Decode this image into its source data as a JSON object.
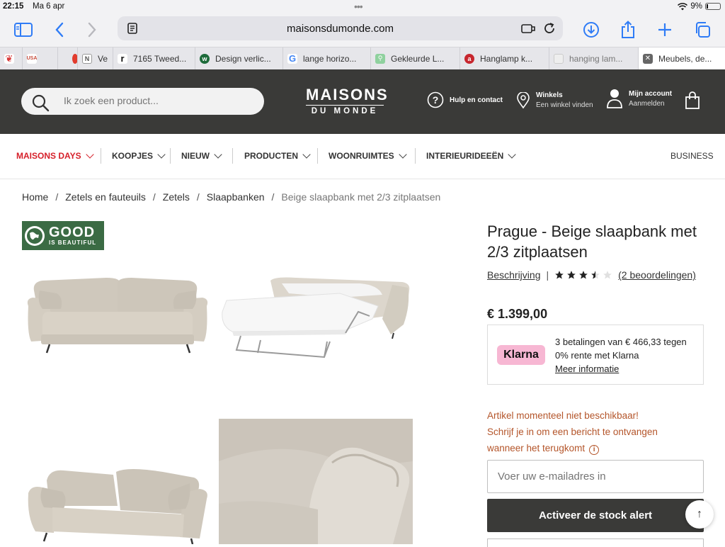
{
  "status": {
    "time": "22:15",
    "date": "Ma 6 apr",
    "battery": "9%"
  },
  "browser": {
    "url": "maisonsdumonde.com"
  },
  "tabs": [
    {
      "label": "",
      "fav_color": "#d93b3b",
      "fav_icon": "leaf-icon"
    },
    {
      "label": "",
      "fav_color": "#c64a3a",
      "fav_icon": "usa-icon"
    },
    {
      "label": "",
      "fav_color": "#e23c2e",
      "fav_icon": "circle-icon"
    },
    {
      "label": "Ve",
      "fav_color": "#555555",
      "fav_icon": "n-icon"
    },
    {
      "label": "7165 Tweed...",
      "fav_color": "#111111",
      "fav_icon": "r-icon"
    },
    {
      "label": "Design verlic...",
      "fav_color": "#1d6b3a",
      "fav_icon": "w-icon"
    },
    {
      "label": "lange horizo...",
      "fav_color": "#4285f4",
      "fav_icon": "google-icon"
    },
    {
      "label": "Gekleurde L...",
      "fav_color": "#8fd19e",
      "fav_icon": "pin-icon"
    },
    {
      "label": "Hanglamp k...",
      "fav_color": "#c7262e",
      "fav_icon": "a-icon"
    },
    {
      "label": "hanging lam...",
      "fav_color": "#dddddd",
      "fav_icon": "page-icon"
    },
    {
      "label": "Meubels, de...",
      "fav_color": "#444444",
      "fav_icon": "x-icon"
    }
  ],
  "header": {
    "search_placeholder": "Ik zoek een product...",
    "logo_line1": "MAISONS",
    "logo_line2": "DU MONDE",
    "help": "Hulp en contact",
    "stores_title": "Winkels",
    "stores_sub": "Een winkel vinden",
    "account_title": "Mijn account",
    "account_sub": "Aanmelden"
  },
  "nav": {
    "items": [
      {
        "label": "MAISONS DAYS",
        "color": "#d6202a"
      },
      {
        "label": "KOOPJES"
      },
      {
        "label": "NIEUW"
      },
      {
        "label": "PRODUCTEN"
      },
      {
        "label": "WOONRUIMTES"
      },
      {
        "label": "INTERIEURIDEEËN"
      }
    ],
    "business": "BUSINESS"
  },
  "breadcrumb": [
    "Home",
    "Zetels en fauteuils",
    "Zetels",
    "Slaapbanken",
    "Beige slaapbank met 2/3 zitplaatsen"
  ],
  "badge": {
    "line1": "GOOD",
    "line2": "IS BEAUTIFUL"
  },
  "product": {
    "title": "Prague - Beige slaapbank met 2/3 zitplaatsen",
    "description_link": "Beschrijving",
    "rating": 3.5,
    "reviews": "(2 beoordelingen)",
    "price": "€ 1.399,00",
    "klarna_logo": "Klarna",
    "klarna_text": "3 betalingen van € 466,33 tegen 0% rente met Klarna",
    "klarna_more": "Meer informatie",
    "oos_line1": "Artikel momenteel niet beschikbaar!",
    "oos_line2": "Schrijf je in om een bericht te ontvangen wanneer het terugkomt",
    "email_placeholder": "Voer uw e-mailadres in",
    "stock_button": "Activeer de stock alert"
  },
  "colors": {
    "header_bg": "#3a3a38",
    "accent_red": "#d6202a",
    "oos_orange": "#b4552a",
    "good_green": "#3b6b44",
    "klarna_pink": "#f7b7d3",
    "ios_blue": "#2f7cf6"
  }
}
